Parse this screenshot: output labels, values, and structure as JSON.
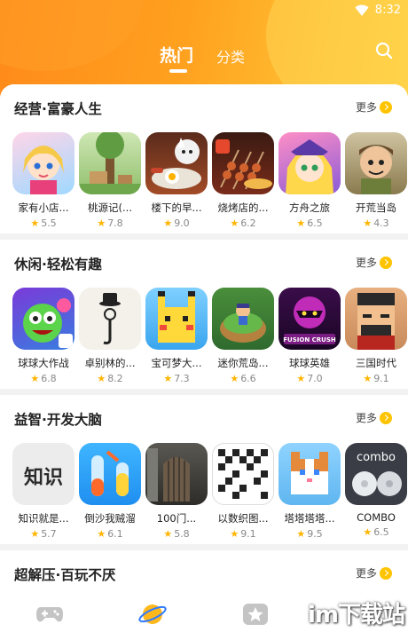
{
  "status_bar": {
    "time": "8:32"
  },
  "tabs": [
    {
      "label": "热门"
    },
    {
      "label": "分类"
    }
  ],
  "more_label": "更多",
  "sections": [
    {
      "title": "经营·富豪人生",
      "apps": [
        {
          "name": "家有小店...",
          "rating": "5.5"
        },
        {
          "name": "桃源记(...",
          "rating": "7.8"
        },
        {
          "name": "楼下的早...",
          "rating": "9.0"
        },
        {
          "name": "烧烤店的...",
          "rating": "6.2"
        },
        {
          "name": "方舟之旅",
          "rating": "6.5"
        },
        {
          "name": "开荒当岛",
          "rating": "4.3"
        }
      ]
    },
    {
      "title": "休闲·轻松有趣",
      "apps": [
        {
          "name": "球球大作战",
          "rating": "6.8"
        },
        {
          "name": "卓别林的...",
          "rating": "8.2"
        },
        {
          "name": "宝可梦大...",
          "rating": "7.3"
        },
        {
          "name": "迷你荒岛...",
          "rating": "6.6"
        },
        {
          "name": "球球英雄",
          "rating": "7.0"
        },
        {
          "name": "三国时代",
          "rating": "9.1"
        }
      ]
    },
    {
      "title": "益智·开发大脑",
      "apps": [
        {
          "name": "知识就是...",
          "rating": "5.7"
        },
        {
          "name": "倒沙我贼溜",
          "rating": "6.1"
        },
        {
          "name": "100门...",
          "rating": "5.8"
        },
        {
          "name": "以数织图...",
          "rating": "9.1"
        },
        {
          "name": "塔塔塔塔...",
          "rating": "9.5"
        },
        {
          "name": "COMBO",
          "rating": "6.5"
        }
      ]
    },
    {
      "title": "超解压·百玩不厌",
      "apps": []
    }
  ],
  "icon_texts": {
    "zhishi": "知识",
    "fusion": "FUSION CRUSH",
    "combo": "combo"
  },
  "watermark": "im下载站",
  "colors": {
    "accent": "#ff9a1f",
    "star": "#ffb400",
    "more_dot": "#ffc400"
  },
  "icons": [
    "wifi-icon",
    "search-icon",
    "star-icon",
    "chevron-right-icon",
    "gamepad-icon",
    "planet-icon",
    "star-nav-icon"
  ]
}
